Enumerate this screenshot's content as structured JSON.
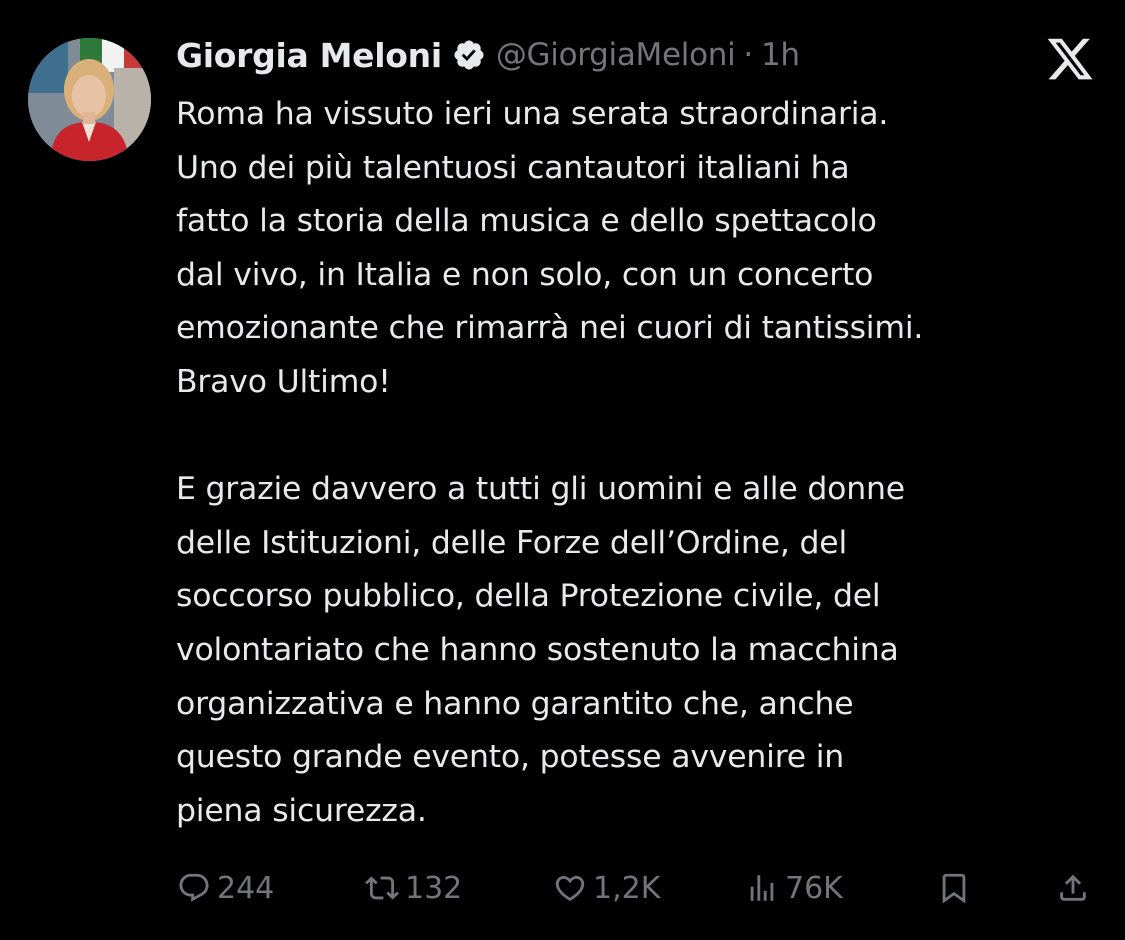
{
  "tweet": {
    "author": {
      "display_name": "Giorgia Meloni",
      "handle": "@GiorgiaMeloni",
      "separator": "·",
      "time": "1h"
    },
    "body_lines": [
      "Roma ha vissuto ieri una serata straordinaria.",
      "Uno dei più talentuosi cantautori italiani ha",
      "fatto la storia della musica e dello spettacolo",
      "dal vivo, in Italia e non solo, con un concerto",
      "emozionante che rimarrà nei cuori di tantissimi.",
      "Bravo Ultimo!",
      "",
      "E grazie davvero a tutti gli uomini e alle donne",
      "delle Istituzioni, delle Forze dell’Ordine, del",
      "soccorso pubblico, della Protezione civile, del",
      "volontariato che hanno sostenuto la macchina",
      "organizzativa e hanno garantito che, anche",
      "questo grande evento, potesse avvenire in",
      "piena sicurezza."
    ],
    "metrics": {
      "replies": "244",
      "reposts": "132",
      "likes": "1,2K",
      "views": "76K"
    }
  },
  "icons": {
    "verified": "verified-badge-icon",
    "brand": "x-logo-icon",
    "reply": "reply-icon",
    "repost": "repost-icon",
    "like": "heart-icon",
    "views": "views-icon",
    "bookmark": "bookmark-icon",
    "share": "share-icon"
  },
  "colors": {
    "background": "#000000",
    "text_primary": "#e7e9ea",
    "text_secondary": "#71767b"
  }
}
